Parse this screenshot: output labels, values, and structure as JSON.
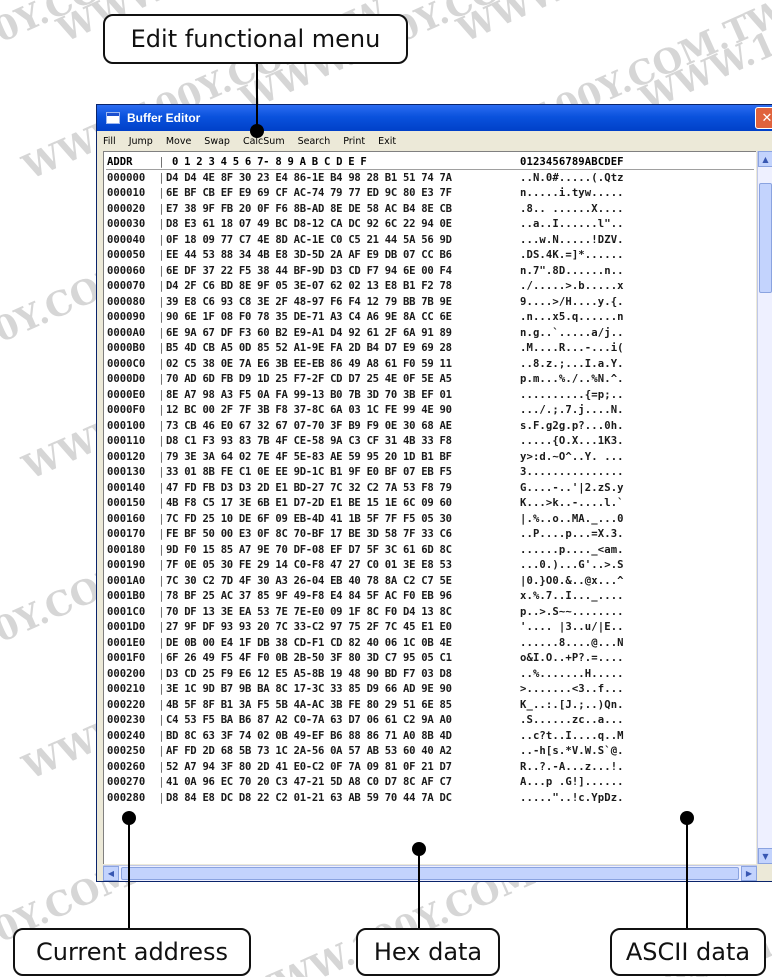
{
  "watermark": "WWW.100Y.COM.TW",
  "callouts": {
    "menu": "Edit functional menu",
    "address": "Current address",
    "hex": "Hex data",
    "ascii": "ASCII data"
  },
  "window": {
    "title": "Buffer Editor",
    "close_glyph": "✕"
  },
  "menu": [
    "Fill",
    "Jump",
    "Move",
    "Swap",
    "CalcSum",
    "Search",
    "Print",
    "Exit"
  ],
  "grid": {
    "header": {
      "addr": "ADDR",
      "sep": "|",
      "hex": "0  1  2  3  4  5  6  7- 8  9  A  B  C  D  E  F",
      "ascii": "0123456789ABCDEF"
    },
    "rows": [
      {
        "addr": "000000",
        "hex": "D4 D4 4E 8F 30 23 E4 86-1E B4 98 28 B1 51 74 7A",
        "ascii": "..N.0#.....(.Qtz"
      },
      {
        "addr": "000010",
        "hex": "6E BF CB EF E9 69 CF AC-74 79 77 ED 9C 80 E3 7F",
        "ascii": "n.....i.tyw....."
      },
      {
        "addr": "000020",
        "hex": "E7 38 9F FB 20 0F F6 8B-AD 8E DE 58 AC B4 8E CB",
        "ascii": ".8.. ......X...."
      },
      {
        "addr": "000030",
        "hex": "D8 E3 61 18 07 49 BC D8-12 CA DC 92 6C 22 94 0E",
        "ascii": "..a..I......l\".."
      },
      {
        "addr": "000040",
        "hex": "0F 18 09 77 C7 4E 8D AC-1E C0 C5 21 44 5A 56 9D",
        "ascii": "...w.N.....!DZV."
      },
      {
        "addr": "000050",
        "hex": "EE 44 53 88 34 4B E8 3D-5D 2A AF E9 DB 07 CC B6",
        "ascii": ".DS.4K.=]*......"
      },
      {
        "addr": "000060",
        "hex": "6E DF 37 22 F5 38 44 BF-9D D3 CD F7 94 6E 00 F4",
        "ascii": "n.7\".8D......n.."
      },
      {
        "addr": "000070",
        "hex": "D4 2F C6 BD 8E 9F 05 3E-07 62 02 13 E8 B1 F2 78",
        "ascii": "./.....>.b.....x"
      },
      {
        "addr": "000080",
        "hex": "39 E8 C6 93 C8 3E 2F 48-97 F6 F4 12 79 BB 7B 9E",
        "ascii": "9....>/H....y.{."
      },
      {
        "addr": "000090",
        "hex": "90 6E 1F 08 F0 78 35 DE-71 A3 C4 A6 9E 8A CC 6E",
        "ascii": ".n...x5.q......n"
      },
      {
        "addr": "0000A0",
        "hex": "6E 9A 67 DF F3 60 B2 E9-A1 D4 92 61 2F 6A 91 89",
        "ascii": "n.g..`.....a/j.."
      },
      {
        "addr": "0000B0",
        "hex": "B5 4D CB A5 0D 85 52 A1-9E FA 2D B4 D7 E9 69 28",
        "ascii": ".M....R...-...i("
      },
      {
        "addr": "0000C0",
        "hex": "02 C5 38 0E 7A E6 3B EE-EB 86 49 A8 61 F0 59 11",
        "ascii": "..8.z.;...I.a.Y."
      },
      {
        "addr": "0000D0",
        "hex": "70 AD 6D FB D9 1D 25 F7-2F CD D7 25 4E 0F 5E A5",
        "ascii": "p.m...%./..%N.^."
      },
      {
        "addr": "0000E0",
        "hex": "8E A7 98 A3 F5 0A FA 99-13 B0 7B 3D 70 3B EF 01",
        "ascii": "..........{=p;.."
      },
      {
        "addr": "0000F0",
        "hex": "12 BC 00 2F 7F 3B F8 37-8C 6A 03 1C FE 99 4E 90",
        "ascii": ".../.;.7.j....N."
      },
      {
        "addr": "000100",
        "hex": "73 CB 46 E0 67 32 67 07-70 3F B9 F9 0E 30 68 AE",
        "ascii": "s.F.g2g.p?...0h."
      },
      {
        "addr": "000110",
        "hex": "D8 C1 F3 93 83 7B 4F CE-58 9A C3 CF 31 4B 33 F8",
        "ascii": ".....{O.X...1K3."
      },
      {
        "addr": "000120",
        "hex": "79 3E 3A 64 02 7E 4F 5E-83 AE 59 95 20 1D B1 BF",
        "ascii": "y>:d.~O^..Y. ..."
      },
      {
        "addr": "000130",
        "hex": "33 01 8B FE C1 0E EE 9D-1C B1 9F E0 BF 07 EB F5",
        "ascii": "3..............."
      },
      {
        "addr": "000140",
        "hex": "47 FD FB D3 D3 2D E1 BD-27 7C 32 C2 7A 53 F8 79",
        "ascii": "G....-..'|2.zS.y"
      },
      {
        "addr": "000150",
        "hex": "4B F8 C5 17 3E 6B E1 D7-2D E1 BE 15 1E 6C 09 60",
        "ascii": "K...>k..-....l.`"
      },
      {
        "addr": "000160",
        "hex": "7C FD 25 10 DE 6F 09 EB-4D 41 1B 5F 7F F5 05 30",
        "ascii": "|.%..o..MA._...0"
      },
      {
        "addr": "000170",
        "hex": "FE BF 50 00 E3 0F 8C 70-BF 17 BE 3D 58 7F 33 C6",
        "ascii": "..P....p...=X.3."
      },
      {
        "addr": "000180",
        "hex": "9D F0 15 85 A7 9E 70 DF-08 EF D7 5F 3C 61 6D 8C",
        "ascii": "......p...._<am."
      },
      {
        "addr": "000190",
        "hex": "7F 0E 05 30 FE 29 14 C0-F8 47 27 C0 01 3E E8 53",
        "ascii": "...0.)...G'..>.S"
      },
      {
        "addr": "0001A0",
        "hex": "7C 30 C2 7D 4F 30 A3 26-04 EB 40 78 8A C2 C7 5E",
        "ascii": "|0.}O0.&..@x...^"
      },
      {
        "addr": "0001B0",
        "hex": "78 BF 25 AC 37 85 9F 49-F8 E4 84 5F AC F0 EB 96",
        "ascii": "x.%.7..I..._...."
      },
      {
        "addr": "0001C0",
        "hex": "70 DF 13 3E EA 53 7E 7E-E0 09 1F 8C F0 D4 13 8C",
        "ascii": "p..>.S~~........"
      },
      {
        "addr": "0001D0",
        "hex": "27 9F DF 93 93 20 7C 33-C2 97 75 2F 7C 45 E1 E0",
        "ascii": "'.... |3..u/|E.."
      },
      {
        "addr": "0001E0",
        "hex": "DE 0B 00 E4 1F DB 38 CD-F1 CD 82 40 06 1C 0B 4E",
        "ascii": "......8....@...N"
      },
      {
        "addr": "0001F0",
        "hex": "6F 26 49 F5 4F F0 0B 2B-50 3F 80 3D C7 95 05 C1",
        "ascii": "o&I.O..+P?.=...."
      },
      {
        "addr": "000200",
        "hex": "D3 CD 25 F9 E6 12 E5 A5-8B 19 48 90 BD F7 03 D8",
        "ascii": "..%.......H....."
      },
      {
        "addr": "000210",
        "hex": "3E 1C 9D B7 9B BA 8C 17-3C 33 85 D9 66 AD 9E 90",
        "ascii": ">.......<3..f..."
      },
      {
        "addr": "000220",
        "hex": "4B 5F 8F B1 3A F5 5B 4A-AC 3B FE 80 29 51 6E 85",
        "ascii": "K_..:.[J.;..)Qn."
      },
      {
        "addr": "000230",
        "hex": "C4 53 F5 BA B6 87 A2 C0-7A 63 D7 06 61 C2 9A A0",
        "ascii": ".S......zc..a..."
      },
      {
        "addr": "000240",
        "hex": "BD 8C 63 3F 74 02 0B 49-EF B6 88 86 71 A0 8B 4D",
        "ascii": "..c?t..I....q..M"
      },
      {
        "addr": "000250",
        "hex": "AF FD 2D 68 5B 73 1C 2A-56 0A 57 AB 53 60 40 A2",
        "ascii": "..-h[s.*V.W.S`@."
      },
      {
        "addr": "000260",
        "hex": "52 A7 94 3F 80 2D 41 E0-C2 0F 7A 09 81 0F 21 D7",
        "ascii": "R..?.-A...z...!."
      },
      {
        "addr": "000270",
        "hex": "41 0A 96 EC 70 20 C3 47-21 5D A8 C0 D7 8C AF C7",
        "ascii": "A...p .G!]......"
      },
      {
        "addr": "000280",
        "hex": "D8 84 E8 DC D8 22 C2 01-21 63 AB 59 70 44 7A DC",
        "ascii": ".....\"..!c.YpDz."
      }
    ]
  }
}
